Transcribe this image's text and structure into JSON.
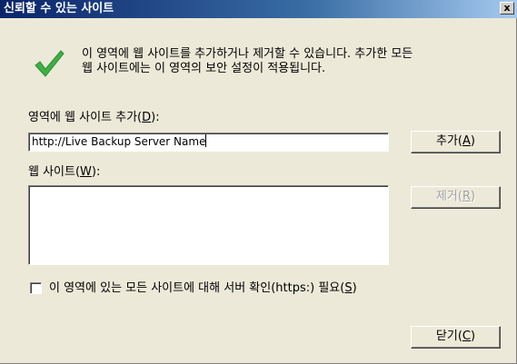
{
  "window": {
    "title": "신뢰할 수 있는 사이트",
    "close_glyph": "x"
  },
  "info": {
    "line1": "이 영역에 웹 사이트를 추가하거나 제거할 수 있습니다. 추가한 모든",
    "line2": "웹 사이트에는 이 영역의 보안 설정이 적용됩니다.",
    "icon": "green-check-icon",
    "icon_color": "#3cb043"
  },
  "add_site": {
    "label_prefix": "영역에 웹 사이트 추가(",
    "label_accel": "D",
    "label_suffix": "):",
    "value": "http://Live Backup Server Name",
    "button_prefix": "추가(",
    "button_accel": "A",
    "button_suffix": ")"
  },
  "sites": {
    "label_prefix": "웹 사이트(",
    "label_accel": "W",
    "label_suffix": "):",
    "items": [],
    "remove_prefix": "제거(",
    "remove_accel": "R",
    "remove_suffix": ")"
  },
  "https_check": {
    "label_prefix": "이 영역에 있는 모든 사이트에 대해 서버 확인(https:) 필요(",
    "label_accel": "S",
    "label_suffix": ")",
    "checked": false
  },
  "close_button": {
    "prefix": "닫기(",
    "accel": "C",
    "suffix": ")"
  }
}
